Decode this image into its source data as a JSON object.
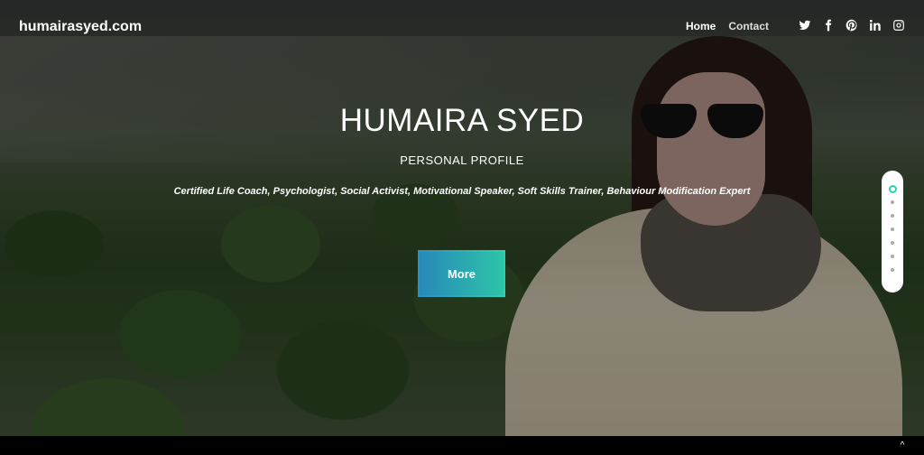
{
  "brand": "humairasyed.com",
  "nav": {
    "items": [
      {
        "label": "Home"
      },
      {
        "label": "Contact"
      }
    ]
  },
  "social": [
    "twitter-icon",
    "facebook-icon",
    "pinterest-icon",
    "linkedin-icon",
    "instagram-icon"
  ],
  "hero": {
    "title": "HUMAIRA SYED",
    "subtitle": "PERSONAL PROFILE",
    "tagline": "Certified Life Coach, Psychologist, Social Activist, Motivational Speaker, Soft Skills Trainer, Behaviour Modification Expert",
    "button_label": "More"
  },
  "colors": {
    "accent_start": "#2a8fc4",
    "accent_end": "#2fd0b0"
  },
  "dot_nav": {
    "count": 7,
    "active_index": 0
  }
}
